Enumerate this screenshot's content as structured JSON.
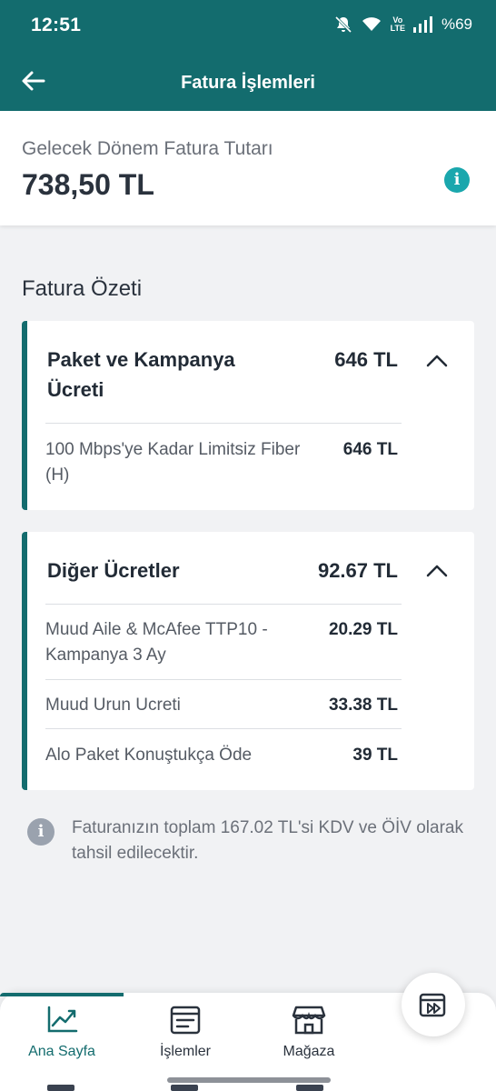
{
  "status_bar": {
    "time": "12:51",
    "network": "Vo LTE",
    "battery": "%69",
    "icons": [
      "mute-icon",
      "wifi-icon",
      "signal-icon"
    ]
  },
  "app_bar": {
    "title": "Fatura İşlemleri",
    "back_icon": "back-arrow-icon"
  },
  "next_bill": {
    "label": "Gelecek Dönem Fatura Tutarı",
    "amount": "738,50 TL",
    "info_icon": "info-icon"
  },
  "summary": {
    "title": "Fatura Özeti",
    "groups": [
      {
        "title": "Paket ve Kampanya Ücreti",
        "total": "646 TL",
        "items": [
          {
            "label": "100 Mbps'ye Kadar Limitsiz Fiber (H)",
            "value": "646 TL"
          }
        ]
      },
      {
        "title": "Diğer Ücretler",
        "total": "92.67 TL",
        "items": [
          {
            "label": "Muud Aile & McAfee TTP10 - Kampanya 3 Ay",
            "value": "20.29 TL"
          },
          {
            "label": "Muud Urun Ucreti",
            "value": "33.38 TL"
          },
          {
            "label": "Alo Paket Konuştukça Öde",
            "value": "39 TL"
          }
        ]
      }
    ]
  },
  "notice": "Faturanızın toplam 167.02 TL'si KDV ve ÖİV olarak tahsil edilecektir.",
  "bottom_nav": {
    "items": [
      {
        "label": "Ana Sayfa",
        "icon": "chart-trend-icon",
        "active": true
      },
      {
        "label": "İşlemler",
        "icon": "invoice-list-icon",
        "active": false
      },
      {
        "label": "Mağaza",
        "icon": "store-icon",
        "active": false
      }
    ],
    "fab_icon": "media-forward-icon"
  },
  "colors": {
    "brand": "#136c6e",
    "accent_info": "#1aa7ad",
    "background": "#f1f2f4"
  }
}
